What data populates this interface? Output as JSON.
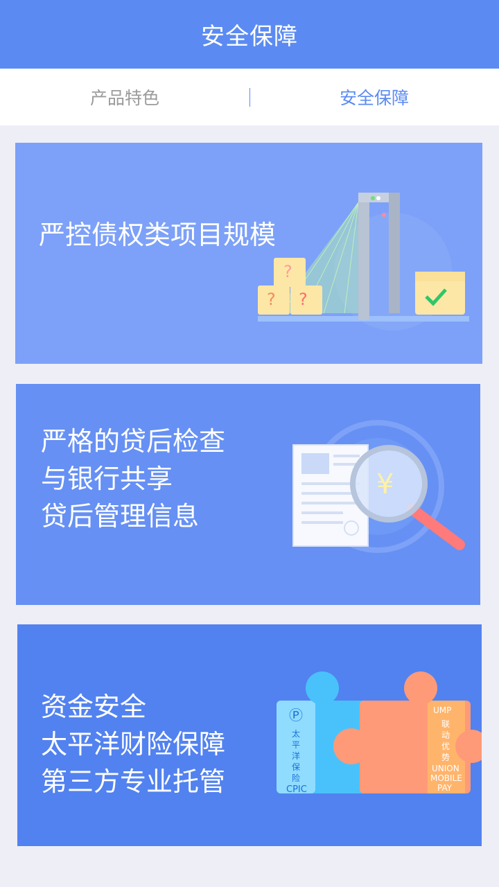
{
  "header": {
    "title": "安全保障"
  },
  "tabs": [
    {
      "label": "产品特色",
      "active": false
    },
    {
      "label": "安全保障",
      "active": true
    }
  ],
  "cards": [
    {
      "lines": [
        "严控债权类项目规模"
      ],
      "bg": "#7da1f8"
    },
    {
      "lines": [
        "严格的贷后检查",
        "与银行共享",
        "贷后管理信息"
      ],
      "bg": "#6690f3"
    },
    {
      "lines": [
        "资金安全",
        "太平洋财险保障",
        "第三方专业托管"
      ],
      "bg": "#5282ef"
    }
  ],
  "illustrations": {
    "yuan_symbol": "¥",
    "question_mark": "?",
    "cpic": {
      "name": "太平洋保险",
      "code": "CPIC"
    },
    "ump": {
      "logo": "UMP",
      "name": "联动优势",
      "en": [
        "UNION",
        "MOBILE",
        "PAY"
      ]
    }
  },
  "colors": {
    "primary": "#5b8bf2",
    "tab_inactive": "#9a9a9a",
    "page_bg": "#eeeef7"
  }
}
